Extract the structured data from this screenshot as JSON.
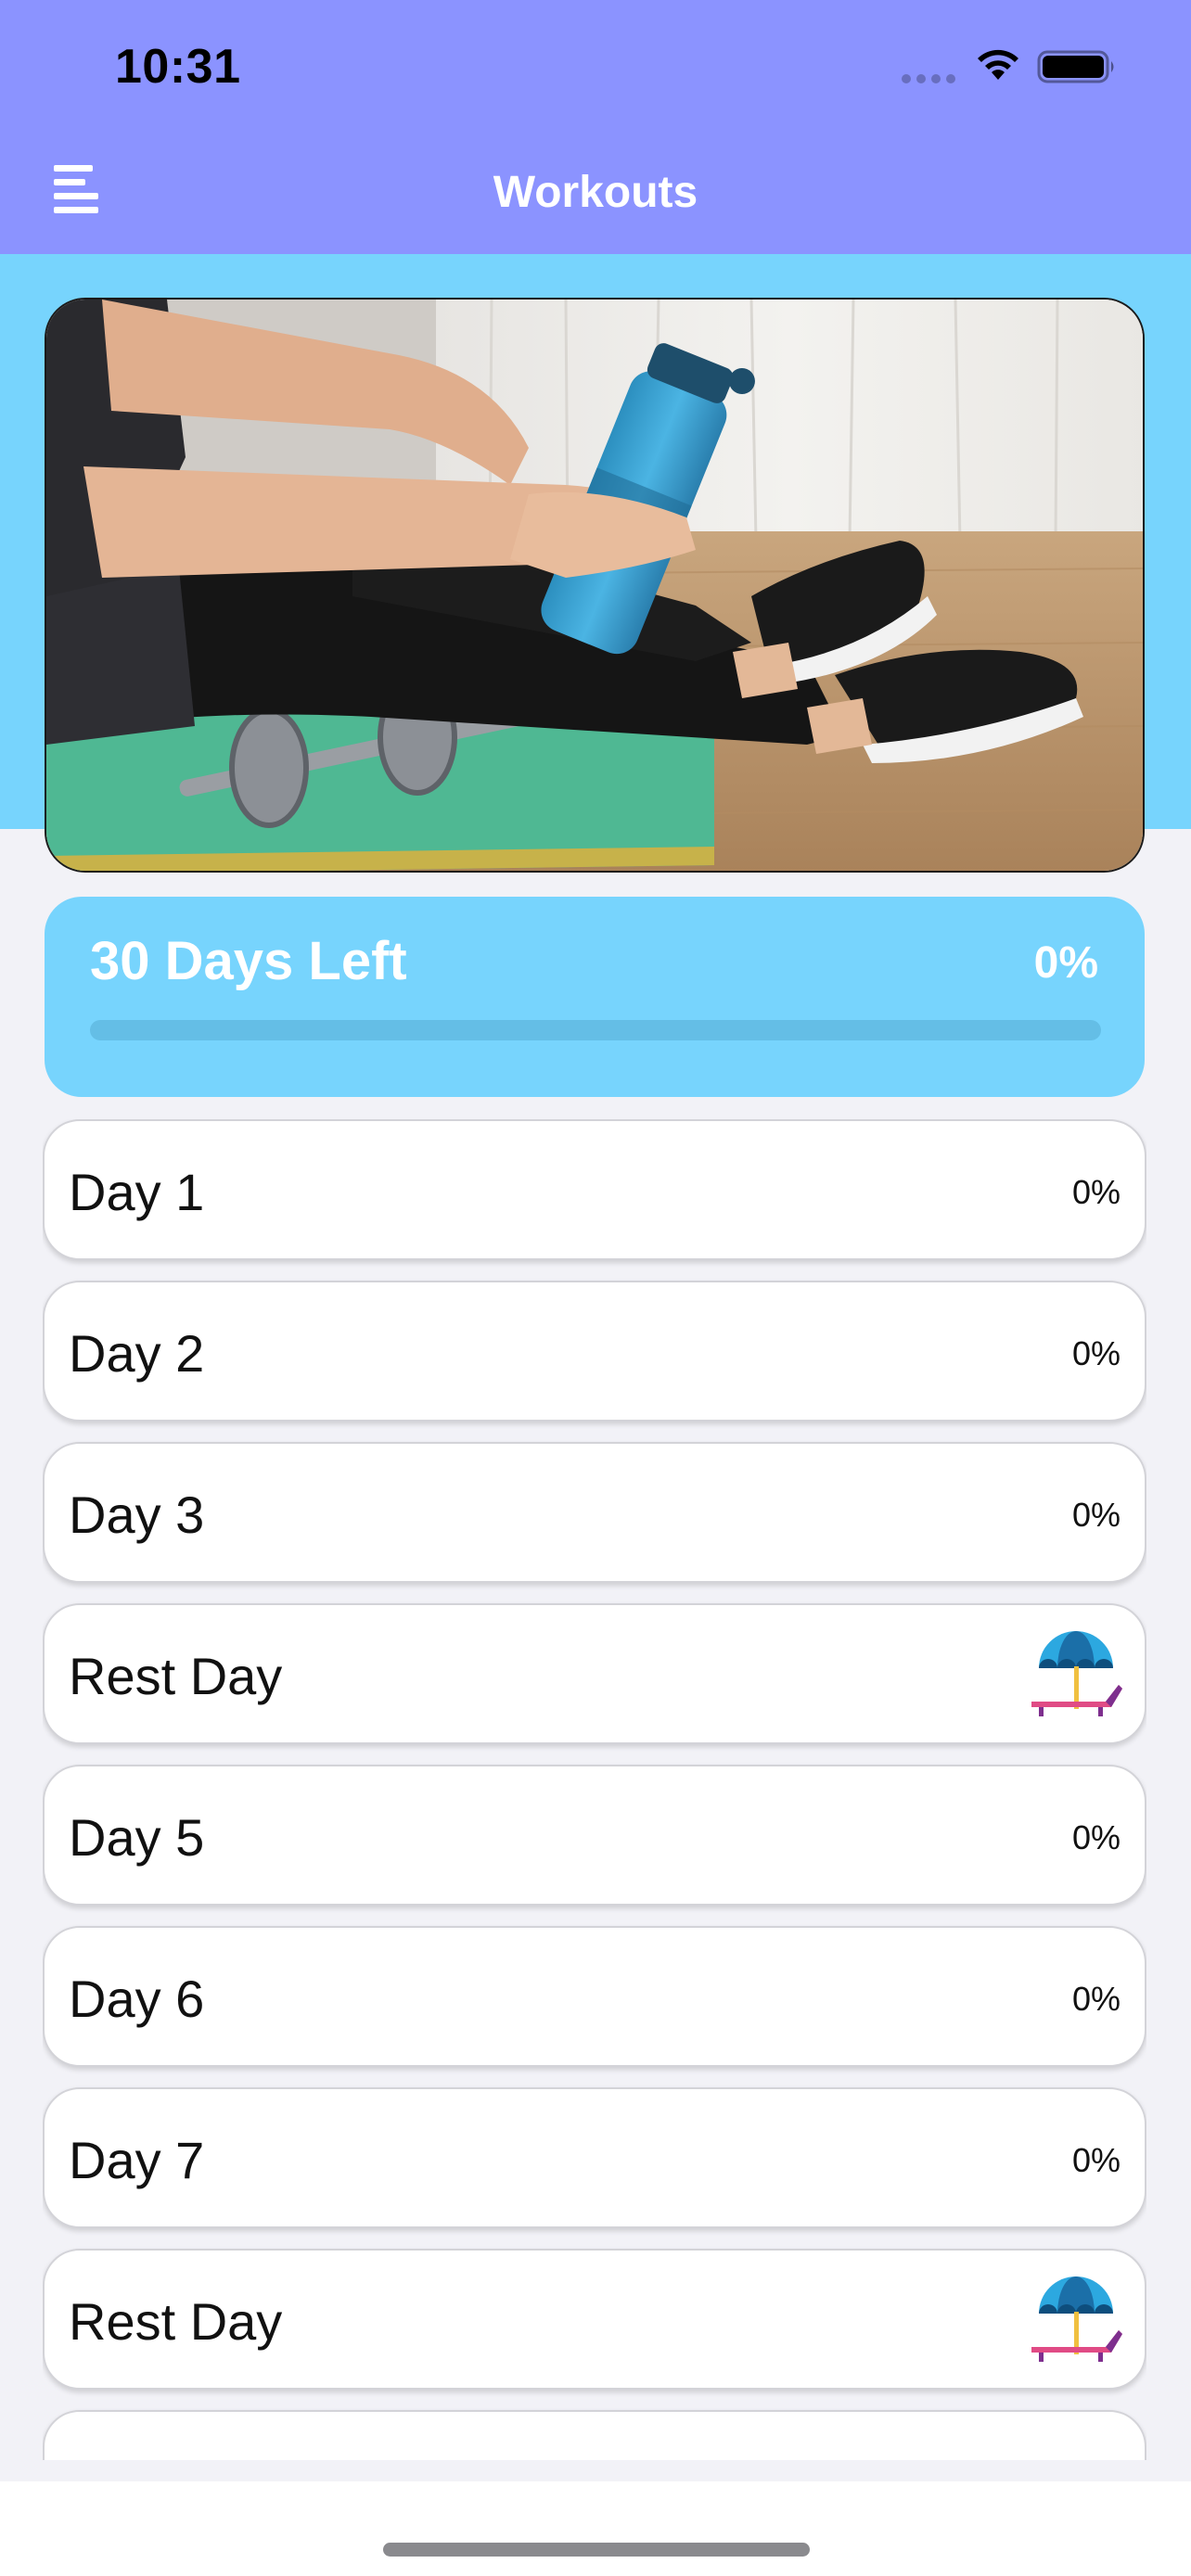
{
  "status_bar": {
    "time": "10:31"
  },
  "nav": {
    "title": "Workouts",
    "menu_icon": "menu-icon"
  },
  "colors": {
    "nav_background": "#8B93FF",
    "accent": "#77D4FD",
    "page_background": "#F2F2F7"
  },
  "progress": {
    "title": "30 Days Left",
    "percent_label": "0%",
    "fraction_complete": 0
  },
  "days": [
    {
      "label": "Day 1",
      "percent": "0%",
      "rest": false
    },
    {
      "label": "Day 2",
      "percent": "0%",
      "rest": false
    },
    {
      "label": "Day 3",
      "percent": "0%",
      "rest": false
    },
    {
      "label": "Rest Day",
      "percent": null,
      "rest": true,
      "icon": "beach-umbrella-lounger-icon"
    },
    {
      "label": "Day 5",
      "percent": "0%",
      "rest": false
    },
    {
      "label": "Day 6",
      "percent": "0%",
      "rest": false
    },
    {
      "label": "Day 7",
      "percent": "0%",
      "rest": false
    },
    {
      "label": "Rest Day",
      "percent": null,
      "rest": true,
      "icon": "beach-umbrella-lounger-icon"
    }
  ]
}
